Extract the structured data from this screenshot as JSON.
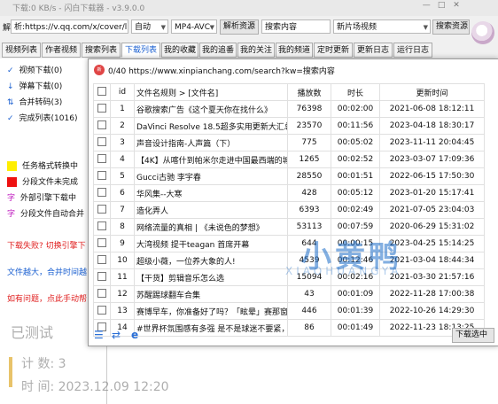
{
  "title_bar": {
    "text": "下载:0 KB/s - 闪白下载器 - v3.9.0.0",
    "min": "—",
    "max": "□",
    "close": "✕"
  },
  "toolbar": {
    "parse_label": "解",
    "url_value": "析:https://v.qq.com/x/cover/l",
    "mode_select": "自动",
    "format_select": "MP4-AVC",
    "parse_button": "解析资源",
    "search_value": "搜索内容",
    "site_select": "新片场视频",
    "search_button": "搜索资源"
  },
  "tabs": [
    "视频列表",
    "作者视频",
    "搜索列表",
    "下载列表",
    "我的收藏",
    "我的追番",
    "我的关注",
    "我的频道",
    "定时更新",
    "更新日志",
    "运行日志"
  ],
  "active_tab": 3,
  "left_panel": {
    "items": [
      {
        "icon": "✓",
        "label": "视频下载(0)"
      },
      {
        "icon": "↓",
        "label": "弹幕下载(0)"
      },
      {
        "icon": "⇅",
        "label": "合并转码(3)"
      },
      {
        "icon": "✓",
        "label": "完成列表(1016)"
      }
    ],
    "legend": [
      {
        "color": "#ffee00",
        "label": "任务格式转换中"
      },
      {
        "color": "#ee1111",
        "label": "分段文件未完成"
      },
      {
        "glyph": "字",
        "label": "外部引擎下载中"
      },
      {
        "glyph": "字",
        "label": "分段文件自动合并"
      }
    ],
    "notes": [
      {
        "text": "下载失败? 切换引擎下",
        "color": "#e02020"
      },
      {
        "text": "文件越大，合并时间越",
        "color": "#1a5fd0"
      },
      {
        "text": "如有问题，点此手动帮",
        "color": "#e02020"
      }
    ],
    "tested": "已测试",
    "count_label": "计  数: 3",
    "time_label": "时  间: 2023.12.09 12:20"
  },
  "popup": {
    "title": "0/40 https://www.xinpianchang.com/search?kw=搜索内容",
    "columns": [
      "id",
      "文件名规则 > [文件名]",
      "播放数",
      "时长",
      "更新时间"
    ],
    "rows": [
      {
        "id": "1",
        "name": "谷歌搜索广告《这个夏天你在找什么》",
        "plays": "76398",
        "dur": "00:02:00",
        "date": "2021-06-08 18:12:11"
      },
      {
        "id": "2",
        "name": "DaVinci Resolve 18.5超多实用更新大汇总 2",
        "plays": "23570",
        "dur": "00:11:56",
        "date": "2023-04-18 18:30:17"
      },
      {
        "id": "3",
        "name": "声音设计指南-人声篇（下）",
        "plays": "775",
        "dur": "00:05:02",
        "date": "2023-11-11 20:04:45"
      },
      {
        "id": "4",
        "name": "【4K】从喀什到帕米尔走进中国最西端的城市",
        "plays": "1265",
        "dur": "00:02:52",
        "date": "2023-03-07 17:09:36"
      },
      {
        "id": "5",
        "name": "Gucci古驰  李宇春",
        "plays": "28550",
        "dur": "00:01:51",
        "date": "2022-06-15 17:50:30"
      },
      {
        "id": "6",
        "name": "华风集--大寒",
        "plays": "428",
        "dur": "00:05:12",
        "date": "2023-01-20 15:17:41"
      },
      {
        "id": "7",
        "name": "造化弄人",
        "plays": "6393",
        "dur": "00:02:49",
        "date": "2021-07-05 23:04:03"
      },
      {
        "id": "8",
        "name": "网络流量的真相 | 《未说色的梦想》",
        "plays": "53113",
        "dur": "00:07:59",
        "date": "2020-06-29 15:31:02"
      },
      {
        "id": "9",
        "name": "大湾视频  提干teagan 首席开幕",
        "plays": "644",
        "dur": "00:00:15",
        "date": "2023-04-25 15:14:25"
      },
      {
        "id": "10",
        "name": "超级小薇，一位养大象的人!",
        "plays": "4539",
        "dur": "00:12:46",
        "date": "2021-03-04 18:44:34"
      },
      {
        "id": "11",
        "name": "【干货】剪辑音乐怎么选",
        "plays": "15094",
        "dur": "00:02:16",
        "date": "2021-03-30 21:57:16"
      },
      {
        "id": "12",
        "name": "苏醒踢球翻车合集",
        "plays": "43",
        "dur": "00:01:09",
        "date": "2022-11-28 17:00:38"
      },
      {
        "id": "13",
        "name": "赛博早车，你准备好了吗？「眩晕」赛那窗GI",
        "plays": "446",
        "dur": "00:01:39",
        "date": "2022-10-26 14:29:30"
      },
      {
        "id": "14",
        "name": "#世界杯氛围感有多强 是不是球迷不要紧，足",
        "plays": "86",
        "dur": "00:01:49",
        "date": "2022-11-23 18:13:25"
      }
    ],
    "download_button": "下载选中",
    "watermark": "小黄鸭",
    "watermark_sub": "XIAOHUANGYA"
  }
}
